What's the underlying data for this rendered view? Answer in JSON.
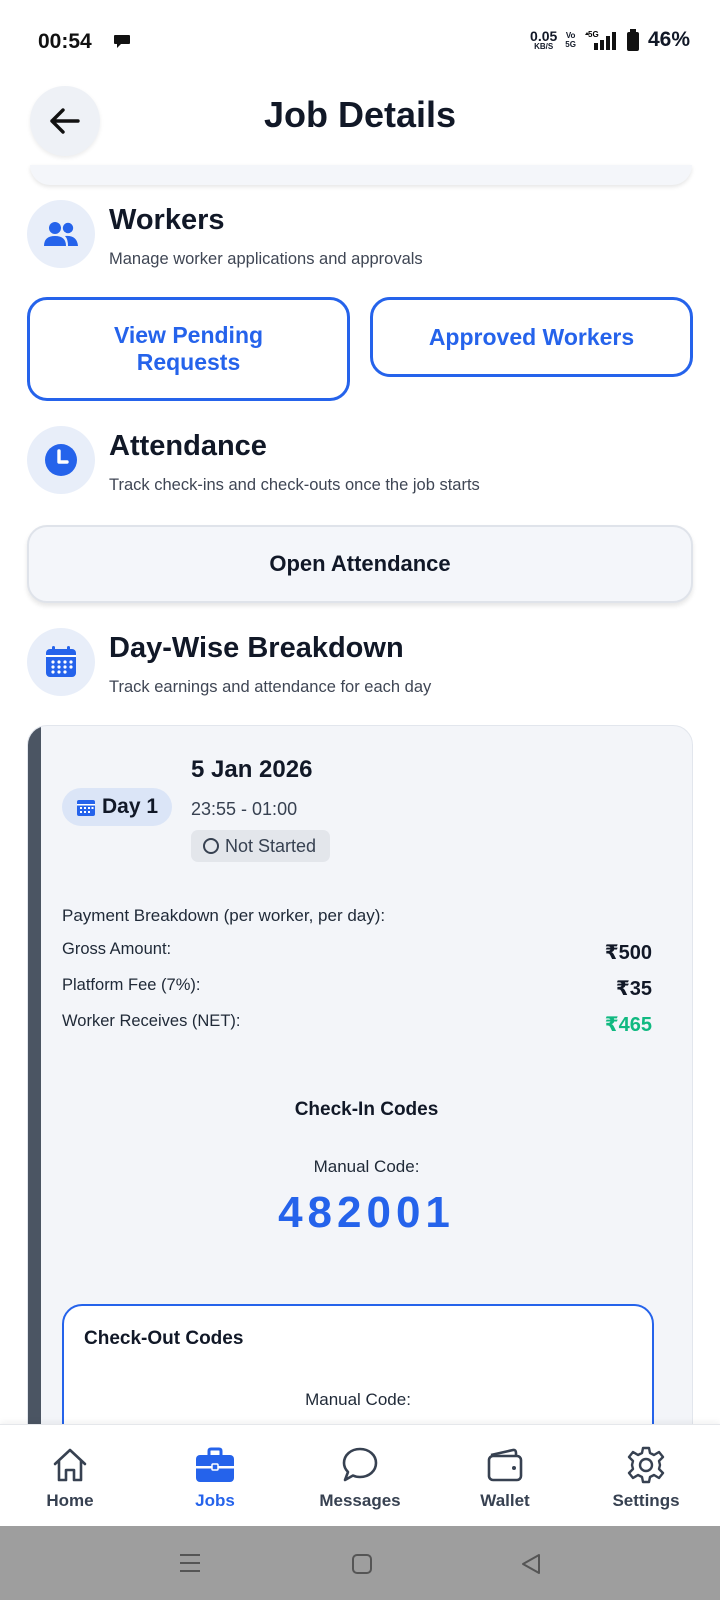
{
  "status_bar": {
    "time": "00:54",
    "net_speed": "0.05",
    "net_unit": "KB/S",
    "volte_top": "Vo",
    "volte_bottom": "5G",
    "signal": "5G",
    "battery": "46%"
  },
  "header": {
    "title": "Job Details",
    "back_icon": "arrow-left-icon"
  },
  "workers": {
    "icon": "people-icon",
    "title": "Workers",
    "subtitle": "Manage worker applications and approvals",
    "pending_label_line1": "View Pending",
    "pending_label_line2": "Requests",
    "approved_label": "Approved Workers"
  },
  "attendance": {
    "icon": "clock-icon",
    "title": "Attendance",
    "subtitle": "Track check-ins and check-outs once the job starts",
    "open_label": "Open Attendance"
  },
  "breakdown": {
    "icon": "calendar-icon",
    "title": "Day-Wise Breakdown",
    "subtitle": "Track earnings and attendance for each day"
  },
  "day": {
    "badge": "Day 1",
    "date": "5 Jan 2026",
    "time": "23:55 - 01:00",
    "status": "Not Started",
    "payment_heading": "Payment Breakdown (per worker, per day):",
    "rows": [
      {
        "label": "Gross Amount:",
        "value": "₹500"
      },
      {
        "label": "Platform Fee (7%):",
        "value": "₹35"
      },
      {
        "label": "Worker Receives (NET):",
        "value": "₹465"
      }
    ],
    "checkin_title": "Check-In Codes",
    "checkin_manual_label": "Manual Code:",
    "checkin_code": "482001",
    "checkout_title": "Check-Out Codes",
    "checkout_manual_label": "Manual Code:"
  },
  "colors": {
    "accent": "#2563eb",
    "net_green": "#10b981"
  },
  "bottom_nav": {
    "active": "Jobs",
    "items": [
      {
        "label": "Home",
        "icon": "home-icon"
      },
      {
        "label": "Jobs",
        "icon": "briefcase-icon"
      },
      {
        "label": "Messages",
        "icon": "chat-icon"
      },
      {
        "label": "Wallet",
        "icon": "wallet-icon"
      },
      {
        "label": "Settings",
        "icon": "gear-icon"
      }
    ]
  }
}
